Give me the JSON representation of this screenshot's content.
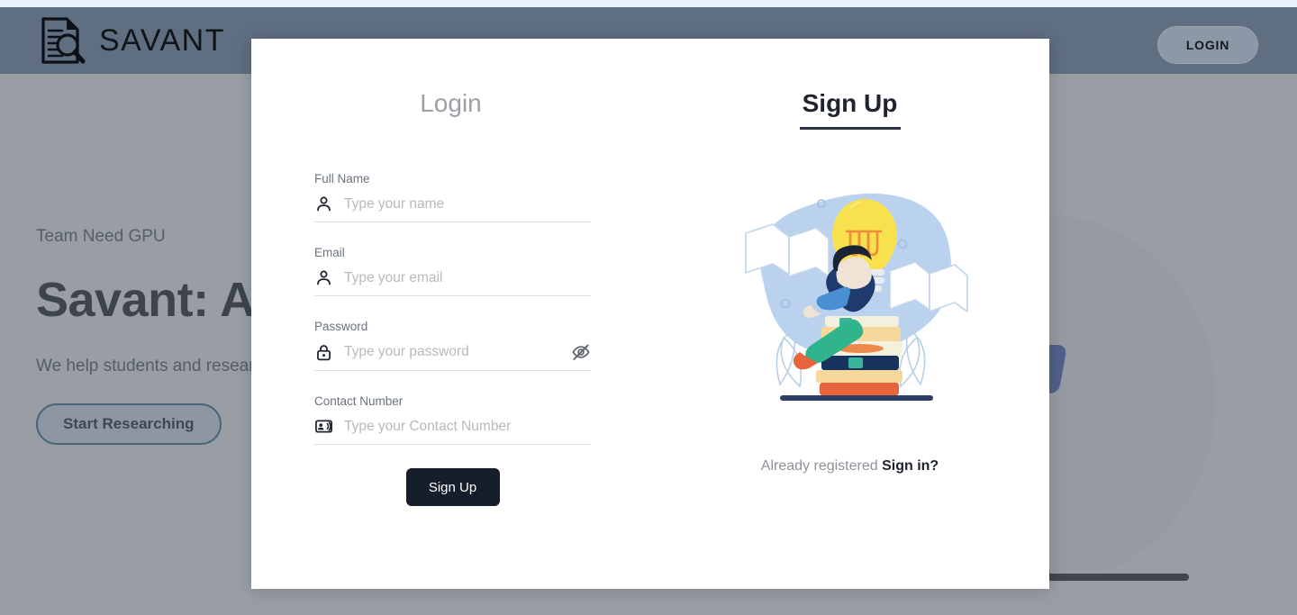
{
  "header": {
    "brand_name": "SAVANT",
    "logo_icon": "document-search-icon",
    "login_button": "LOGIN"
  },
  "hero": {
    "eyebrow": "Team Need GPU",
    "title": "Savant: A Research",
    "subtitle": "We help students and researchers make the process easier, streamlined",
    "cta_button": "Start Researching"
  },
  "modal": {
    "tabs": [
      {
        "label": "Login",
        "active": false
      },
      {
        "label": "Sign Up",
        "active": true
      }
    ],
    "form": {
      "fields": [
        {
          "label": "Full Name",
          "placeholder": "Type your name",
          "value": "",
          "icon": "person-icon",
          "type": "text"
        },
        {
          "label": "Email",
          "placeholder": "Type your email",
          "value": "",
          "icon": "person-icon",
          "type": "email"
        },
        {
          "label": "Password",
          "placeholder": "Type your password",
          "value": "",
          "icon": "lock-icon",
          "type": "password",
          "trailing_icon": "eye-off-icon"
        },
        {
          "label": "Contact Number",
          "placeholder": "Type your Contact Number",
          "value": "",
          "icon": "contact-card-icon",
          "type": "tel"
        }
      ],
      "submit_label": "Sign Up"
    },
    "illustration": "person-reading-on-books-with-lightbulb",
    "footer": {
      "prompt": "Already registered",
      "link": "Sign in?"
    }
  },
  "colors": {
    "header_bar": "#5f6e81",
    "top_strip": "#e8f0fb",
    "submit_button": "#161d2b",
    "tab_active": "#1f2430",
    "tab_inactive": "#9aa0a6",
    "cta_border": "#2a6b86",
    "overlay": "rgba(92,100,112,.62)"
  }
}
